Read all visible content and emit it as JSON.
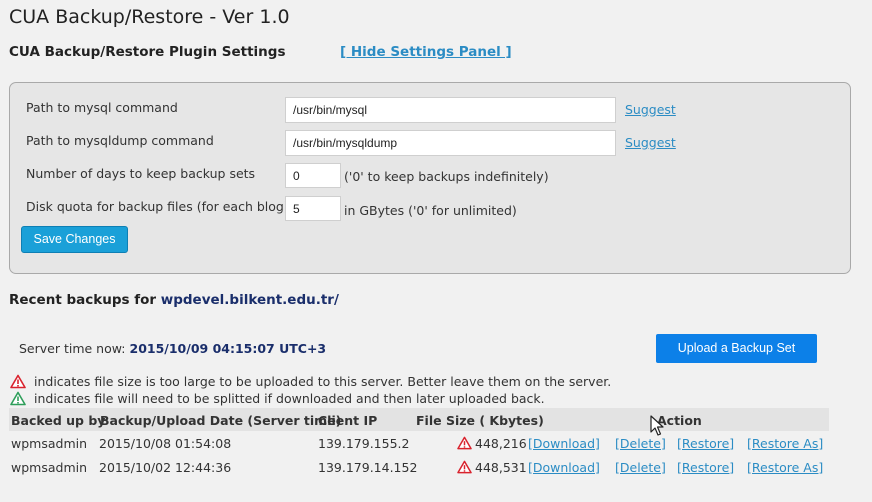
{
  "page": {
    "title": "CUA Backup/Restore - Ver 1.0"
  },
  "settings": {
    "title": "CUA Backup/Restore Plugin Settings",
    "hide_link": "[ Hide Settings Panel ]",
    "mysql_label": "Path to mysql command",
    "mysql_value": "/usr/bin/mysql",
    "mysqldump_label": "Path to mysqldump command",
    "mysqldump_value": "/usr/bin/mysqldump",
    "suggest_label": "Suggest",
    "days_label": "Number of days to keep backup sets",
    "days_value": "0",
    "days_hint": "('0' to keep backups indefinitely)",
    "quota_label": "Disk quota for backup files (for each blog)",
    "quota_value": "5",
    "quota_hint": "in GBytes ('0' for unlimited)",
    "save_label": "Save Changes"
  },
  "recent": {
    "title_prefix": "Recent backups for",
    "host": "wpdevel.bilkent.edu.tr/",
    "server_time_label": "Server time now:",
    "server_time_value": "2015/10/09 04:15:07 UTC+3",
    "upload_button": "Upload a Backup Set",
    "legend_red": "indicates file size is too large to be uploaded to this server. Better leave them on the server.",
    "legend_green": "indicates file will need to be splitted if downloaded and then later uploaded back."
  },
  "colors": {
    "warn_red": "#d9232e",
    "warn_green": "#2e9e5a",
    "link": "#2b8cc4"
  },
  "table": {
    "headers": [
      "Backed up by",
      "Backup/Upload Date (Server time)",
      "Client IP",
      "File Size ( Kbytes)",
      "Action"
    ],
    "rows": [
      {
        "user": "wpmsadmin",
        "date": "2015/10/08 01:54:08",
        "ip": "139.179.155.2",
        "size": "448,216",
        "actions": [
          "[Download]",
          "[Delete]",
          "[Restore]",
          "[Restore As]"
        ]
      },
      {
        "user": "wpmsadmin",
        "date": "2015/10/02 12:44:36",
        "ip": "139.179.14.152",
        "size": "448,531",
        "actions": [
          "[Download]",
          "[Delete]",
          "[Restore]",
          "[Restore As]"
        ]
      }
    ]
  }
}
